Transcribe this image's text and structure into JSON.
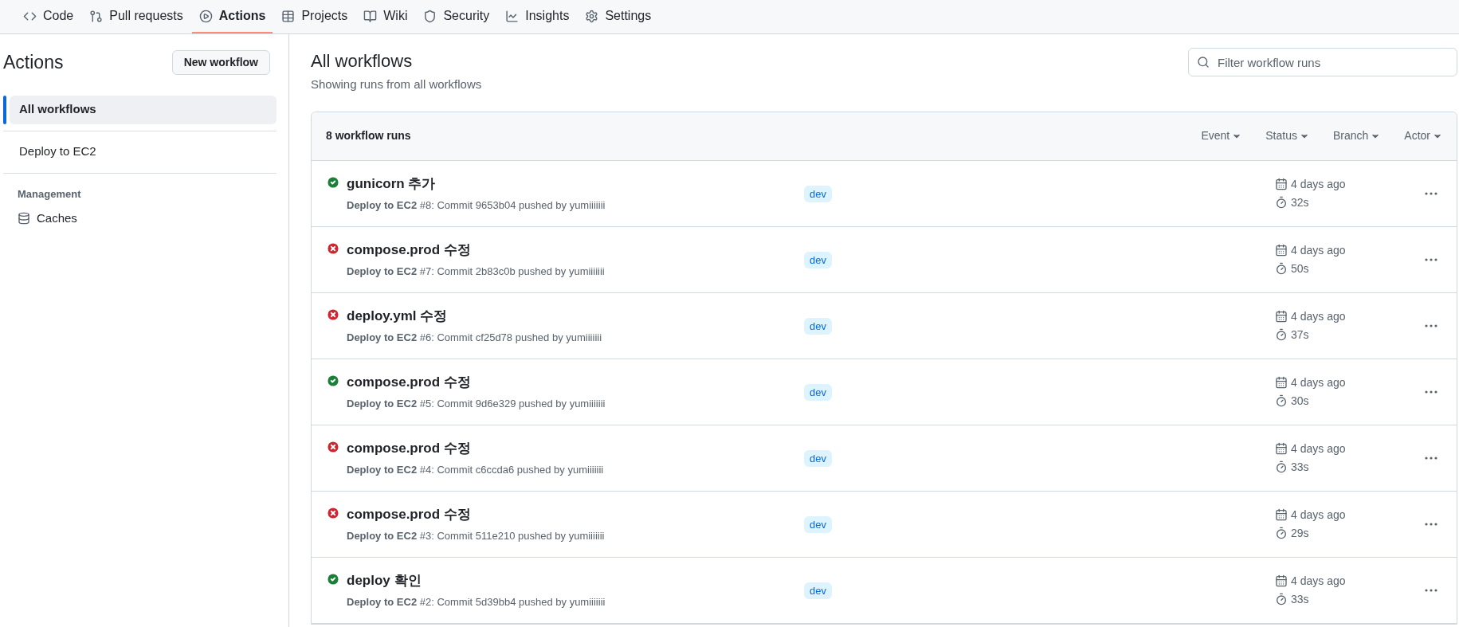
{
  "tabs": [
    {
      "label": "Code",
      "selected": false
    },
    {
      "label": "Pull requests",
      "selected": false
    },
    {
      "label": "Actions",
      "selected": true
    },
    {
      "label": "Projects",
      "selected": false
    },
    {
      "label": "Wiki",
      "selected": false
    },
    {
      "label": "Security",
      "selected": false
    },
    {
      "label": "Insights",
      "selected": false
    },
    {
      "label": "Settings",
      "selected": false
    }
  ],
  "sidebar": {
    "title": "Actions",
    "new_button": "New workflow",
    "items": [
      {
        "label": "All workflows",
        "selected": true
      },
      {
        "label": "Deploy to EC2",
        "selected": false
      }
    ],
    "section": "Management",
    "management_items": [
      {
        "label": "Caches"
      }
    ]
  },
  "main": {
    "title": "All workflows",
    "subtitle": "Showing runs from all workflows",
    "filter_placeholder": "Filter workflow runs",
    "table": {
      "count": "8 workflow runs",
      "filters": [
        "Event",
        "Status",
        "Branch",
        "Actor"
      ],
      "rows": [
        {
          "title": "gunicorn 추가",
          "kind": "success",
          "detail": "**Deploy to EC2** #8: Commit 9653b04 pushed by yumiiiiiii",
          "branch": "dev",
          "date": "4 days ago",
          "duration": "32s"
        },
        {
          "title": "compose.prod 수정",
          "kind": "failure",
          "detail": "**Deploy to EC2** #7: Commit 2b83c0b pushed by yumiiiiiii",
          "branch": "dev",
          "date": "4 days ago",
          "duration": "50s"
        },
        {
          "title": "deploy.yml 수정",
          "kind": "failure",
          "detail": "**Deploy to EC2** #6: Commit cf25d78 pushed by yumiiiiiii",
          "branch": "dev",
          "date": "4 days ago",
          "duration": "37s"
        },
        {
          "title": "compose.prod 수정",
          "kind": "success",
          "detail": "**Deploy to EC2** #5: Commit 9d6e329 pushed by yumiiiiiii",
          "branch": "dev",
          "date": "4 days ago",
          "duration": "30s"
        },
        {
          "title": "compose.prod 수정",
          "kind": "failure",
          "detail": "**Deploy to EC2** #4: Commit c6ccda6 pushed by yumiiiiiii",
          "branch": "dev",
          "date": "4 days ago",
          "duration": "33s"
        },
        {
          "title": "compose.prod 수정",
          "kind": "failure",
          "detail": "**Deploy to EC2** #3: Commit 511e210 pushed by yumiiiiiii",
          "branch": "dev",
          "date": "4 days ago",
          "duration": "29s"
        },
        {
          "title": "deploy 확인",
          "kind": "success",
          "detail": "**Deploy to EC2** #2: Commit 5d39bb4 pushed by yumiiiiiii",
          "branch": "dev",
          "date": "4 days ago",
          "duration": "33s"
        }
      ]
    }
  }
}
